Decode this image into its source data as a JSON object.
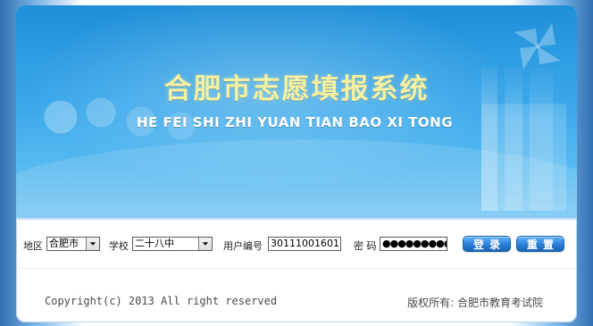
{
  "banner": {
    "title_cn": "合肥市志愿填报系统",
    "title_en": "HE FEI SHI ZHI YUAN TIAN BAO XI TONG",
    "decor": {
      "pinwheel_icon": "pinwheel-icon",
      "students_image": "students-image",
      "buildings_image": "buildings-image"
    },
    "colors": {
      "sky_blue": "#3aa7ea",
      "title_yellow": "#f6f0a0"
    }
  },
  "form": {
    "district_label": "地区",
    "district_value": "合肥市",
    "school_label": "学校",
    "school_value": "二十八中",
    "user_id_label": "用户编号",
    "user_id_value": "30111001601",
    "password_label": "密 码",
    "password_value": "●●●●●●●●●●",
    "login_button": "登录",
    "reset_button": "重置",
    "colors": {
      "button_blue": "#2b7fd6"
    }
  },
  "footer": {
    "copyright": "Copyright(c) 2013  All right reserved",
    "rights_holder": "版权所有: 合肥市教育考试院"
  }
}
